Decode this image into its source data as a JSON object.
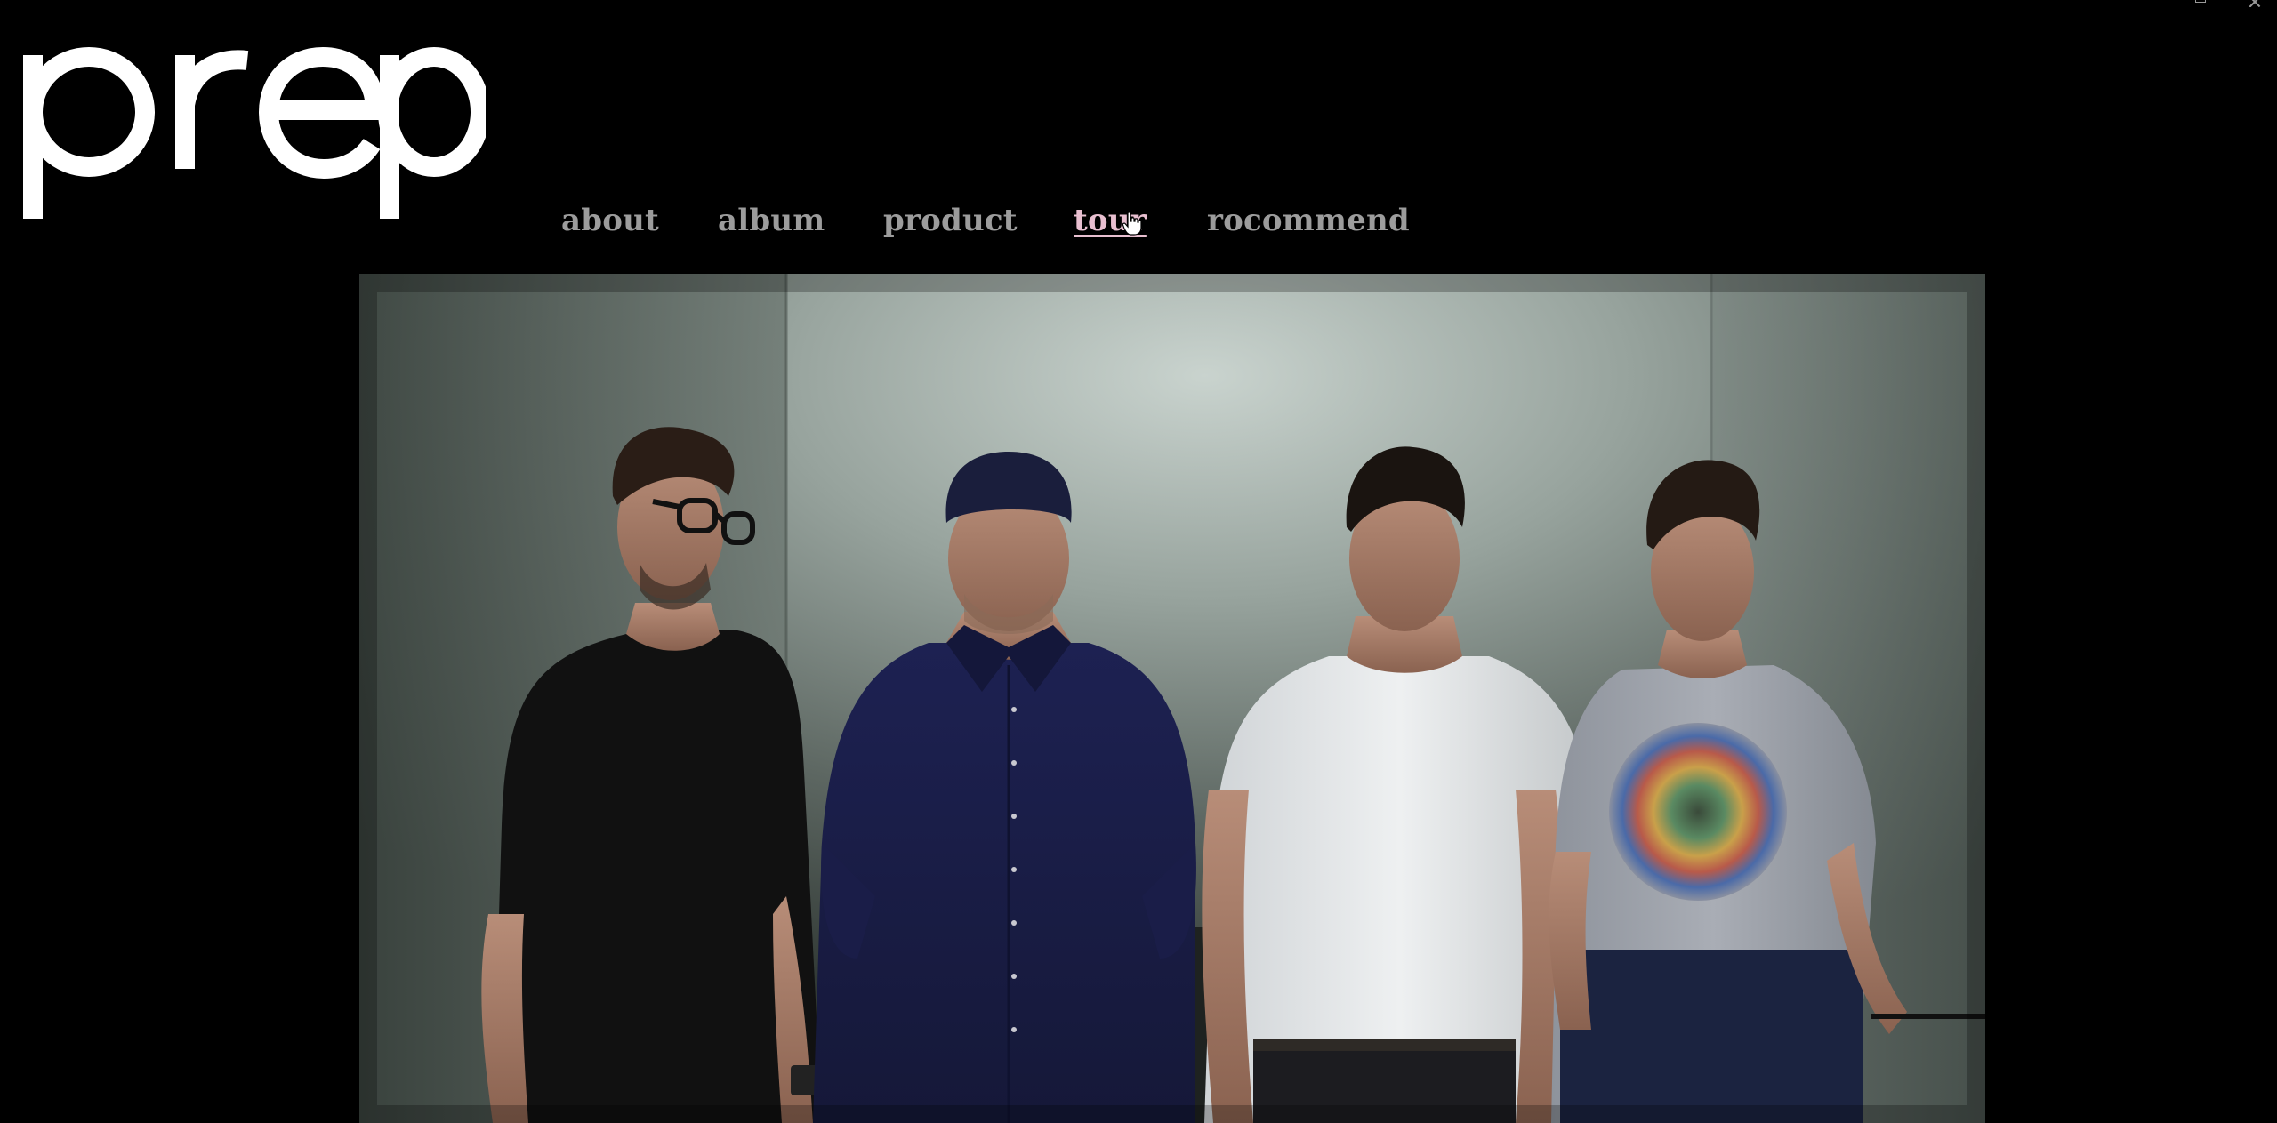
{
  "site": {
    "logo_text": "prep"
  },
  "nav": {
    "items": [
      {
        "label": "about",
        "active": false
      },
      {
        "label": "album",
        "active": false
      },
      {
        "label": "product",
        "active": false
      },
      {
        "label": "tour",
        "active": true
      },
      {
        "label": "rocommend",
        "active": false
      }
    ]
  },
  "colors": {
    "background": "#000000",
    "nav_text": "#9c9c9c",
    "nav_active": "#e8bfd0",
    "logo": "#ffffff"
  },
  "hero": {
    "subject": "band-photo-four-members"
  },
  "icons": {
    "cursor": "hand-pointer-icon",
    "restore": "window-restore-icon",
    "close": "window-close-icon"
  }
}
